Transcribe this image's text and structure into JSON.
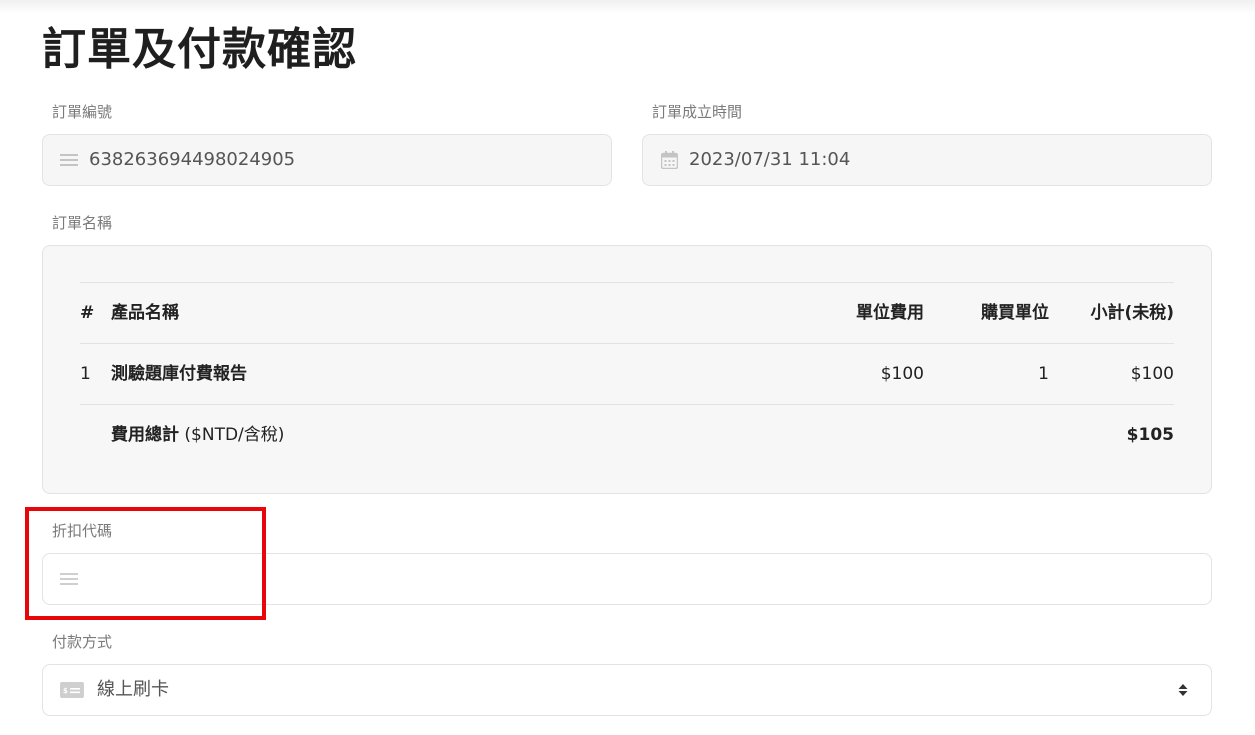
{
  "page": {
    "title": "訂單及付款確認"
  },
  "order_number": {
    "label": "訂單編號",
    "value": "638263694498024905",
    "icon": "list-icon"
  },
  "order_time": {
    "label": "訂單成立時間",
    "value": "2023/07/31 11:04",
    "icon": "calendar-icon"
  },
  "order_name": {
    "label": "訂單名稱",
    "table": {
      "headers": {
        "index": "#",
        "product": "產品名稱",
        "unit_price": "單位費用",
        "quantity": "購買單位",
        "subtotal": "小計(未稅)"
      },
      "rows": [
        {
          "index": "1",
          "product": "測驗題庫付費報告",
          "unit_price": "$100",
          "quantity": "1",
          "subtotal": "$100"
        }
      ],
      "total": {
        "label": "費用總計",
        "note": "($NTD/含稅)",
        "value": "$105"
      }
    }
  },
  "discount_code": {
    "label": "折扣代碼",
    "value": "",
    "placeholder": "",
    "icon": "list-icon"
  },
  "payment_method": {
    "label": "付款方式",
    "selected": "線上刷卡",
    "icon": "credit-card-icon"
  },
  "colors": {
    "highlight": "#e8060a",
    "field_bg": "#f6f6f6",
    "border": "#e3e3e3"
  }
}
